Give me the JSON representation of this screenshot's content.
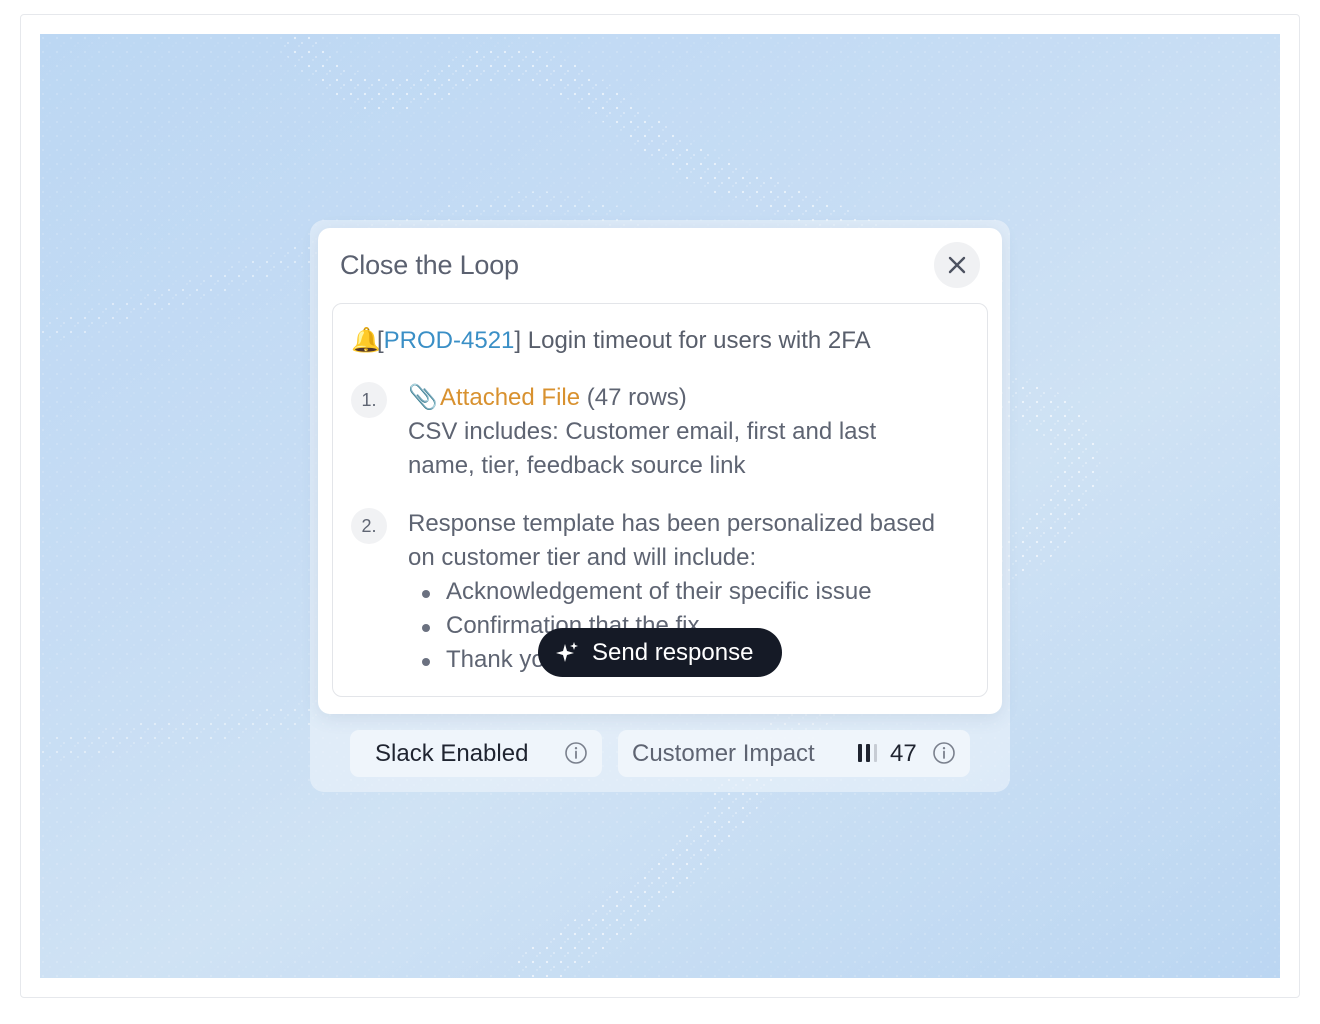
{
  "modal": {
    "title": "Close the Loop",
    "ticket": {
      "bell": "🔔",
      "open_bracket": "[",
      "id": "PROD-4521",
      "close_bracket": "]",
      "title": " Login timeout for users with 2FA"
    },
    "items": [
      {
        "number": "1.",
        "clip": "📎",
        "link": "Attached File",
        "link_suffix": " (47 rows)",
        "text": "CSV includes: Customer email, first and last name, tier, feedback source link"
      },
      {
        "number": "2.",
        "text": "Response template has been personalized based on customer tier and will include:",
        "bullets": [
          "Acknowledgement of their specific issue",
          "Confirmation that the fix",
          "Thank you"
        ]
      }
    ],
    "send_button": "Send response"
  },
  "status": {
    "slack": "Slack Enabled",
    "impact_label": "Customer Impact",
    "impact_value": "47"
  },
  "colors": {
    "ticket_link": "#3a8fc6",
    "attached_link": "#d8912f",
    "send_button_bg": "#151a26",
    "background": "#bcd7f3"
  },
  "icons": {
    "close": "close-icon",
    "bell": "bell-icon",
    "clip": "paperclip-icon",
    "sparkle": "sparkle-icon",
    "info": "info-icon",
    "impact": "signal-bars-icon"
  }
}
